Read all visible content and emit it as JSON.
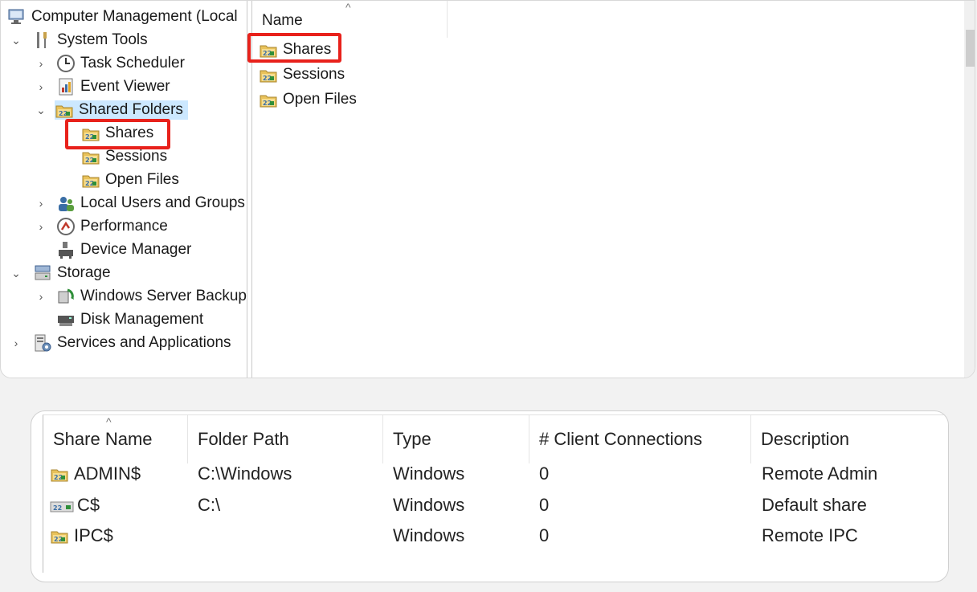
{
  "tree": {
    "root": "Computer Management (Local",
    "system_tools": "System Tools",
    "task_scheduler": "Task Scheduler",
    "event_viewer": "Event Viewer",
    "shared_folders": "Shared Folders",
    "shares": "Shares",
    "sessions": "Sessions",
    "open_files": "Open Files",
    "local_users": "Local Users and Groups",
    "performance": "Performance",
    "device_manager": "Device Manager",
    "storage": "Storage",
    "windows_server_backup": "Windows Server Backup",
    "disk_management": "Disk Management",
    "services_apps": "Services and Applications"
  },
  "list": {
    "header": "Name",
    "items": [
      "Shares",
      "Sessions",
      "Open Files"
    ]
  },
  "shares_table": {
    "columns": [
      "Share Name",
      "Folder Path",
      "Type",
      "# Client Connections",
      "Description"
    ],
    "rows": [
      {
        "name": "ADMIN$",
        "path": "C:\\Windows",
        "type": "Windows",
        "connections": "0",
        "description": "Remote Admin"
      },
      {
        "name": "C$",
        "path": "C:\\",
        "type": "Windows",
        "connections": "0",
        "description": "Default share"
      },
      {
        "name": "IPC$",
        "path": "",
        "type": "Windows",
        "connections": "0",
        "description": "Remote IPC"
      }
    ]
  },
  "colors": {
    "highlight": "#e8211b",
    "selection": "#cce8ff",
    "folder": "#e9c25b"
  }
}
